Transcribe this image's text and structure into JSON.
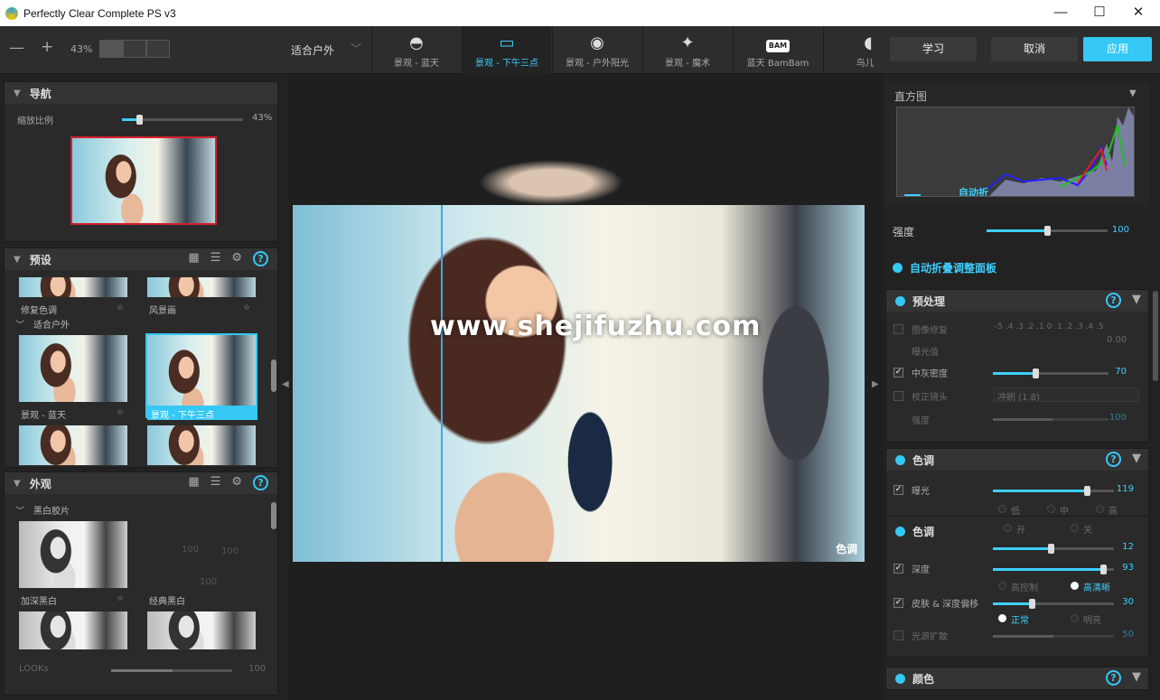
{
  "window": {
    "title": "Perfectly Clear Complete PS v3",
    "minimize": "—",
    "maximize": "☐",
    "close": "✕"
  },
  "toolbar": {
    "zoom_out": "—",
    "zoom_in": "+",
    "zoom_level": "43%",
    "fit_select": "适合户外",
    "presets": [
      {
        "label": "景观 - 蓝天",
        "icon": "sunrise-icon"
      },
      {
        "label": "景观 - 下午三点",
        "icon": "landscape-icon"
      },
      {
        "label": "景观 - 户外阳光",
        "icon": "mountain-icon"
      },
      {
        "label": "景观 - 魔术",
        "icon": "magic-wand-icon"
      },
      {
        "label": "蓝天 BamBam",
        "icon": "bam-icon",
        "badge": "BAM"
      },
      {
        "label": "鸟儿 -",
        "icon": "bird-icon"
      }
    ],
    "learn": "学习",
    "cancel": "取消",
    "apply": "应用"
  },
  "nav": {
    "title": "导航",
    "zoom_label": "缩放比例",
    "zoom_value": "43%",
    "zoom_pct": 0.43
  },
  "presets_panel": {
    "title": "预设",
    "help": "?",
    "items_top": [
      {
        "label": "修复色调"
      },
      {
        "label": "风景画"
      }
    ],
    "group": "适合户外",
    "items": [
      {
        "label": "景观 - 蓝天"
      },
      {
        "label": "景观 - 下午三点"
      }
    ]
  },
  "looks_panel": {
    "title": "外观",
    "help": "?",
    "group": "黑白胶片",
    "items": [
      {
        "label": "加深黑白"
      },
      {
        "label": "经典黑白"
      }
    ],
    "looks_label": "LOOKs",
    "looks_value": "100",
    "ghost_values": [
      "100",
      "100",
      "100"
    ]
  },
  "canvas": {
    "watermark": "www.shejifuzhu.com",
    "tone_tag": "色调"
  },
  "histogram": {
    "title": "直方图",
    "auto_label": "自动折"
  },
  "strength": {
    "label": "强度",
    "value": "100",
    "pct": 0.6
  },
  "auto_fold": "自动折叠调整面板",
  "preprocess": {
    "title": "预处理",
    "help": "?",
    "image_fix": "图像修复",
    "exposure_comp": "曝光值",
    "scale": "-5 .4 .3 .2 .1 0 .1 .2 .3 .4 .5",
    "scale_value": "0.00",
    "midtone": "中灰密度",
    "midtone_value": "70",
    "midtone_pct": 0.38,
    "lens": "校正镜头",
    "lens_select": "冲刷 (1.8)",
    "lens_strength": "强度",
    "lens_value": "100"
  },
  "tone": {
    "title": "色调",
    "help": "?",
    "exposure": "曝光",
    "exposure_value": "119",
    "exposure_pct": 0.77,
    "radio1": [
      "低",
      "中",
      "高"
    ],
    "radio2": [
      "开",
      "关"
    ]
  },
  "tone2": {
    "title": "色调",
    "value1": "12",
    "depth": "深度",
    "depth_value": "93",
    "depth_pct": 0.9,
    "mode": [
      "高控制",
      "高清晰"
    ],
    "skin": "皮肤 & 深度偏移",
    "skin_value": "30",
    "skin_pct": 0.31,
    "mode2": [
      "正常",
      "明亮"
    ],
    "light": "光源扩散",
    "light_value": "50"
  },
  "color": {
    "title": "颜色",
    "help": "?"
  },
  "accent": "#35c8f5"
}
